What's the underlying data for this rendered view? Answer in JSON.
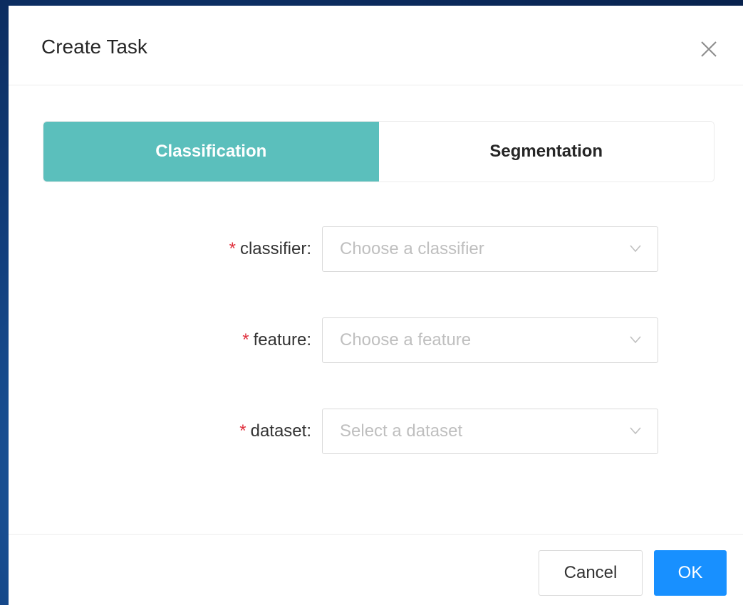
{
  "modal": {
    "title": "Create Task"
  },
  "tabs": [
    {
      "label": "Classification",
      "active": true
    },
    {
      "label": "Segmentation",
      "active": false
    }
  ],
  "form": {
    "required_mark": "*",
    "fields": [
      {
        "label": "classifier:",
        "placeholder": "Choose a classifier"
      },
      {
        "label": "feature:",
        "placeholder": "Choose a feature"
      },
      {
        "label": "dataset:",
        "placeholder": "Select a dataset"
      }
    ]
  },
  "footer": {
    "cancel_label": "Cancel",
    "ok_label": "OK"
  },
  "colors": {
    "tab_active_bg": "#5bbfbc",
    "primary": "#1890ff",
    "required": "#e0303d"
  },
  "icons": {
    "close": "close-icon",
    "select_arrow": "chevron-down-icon"
  }
}
